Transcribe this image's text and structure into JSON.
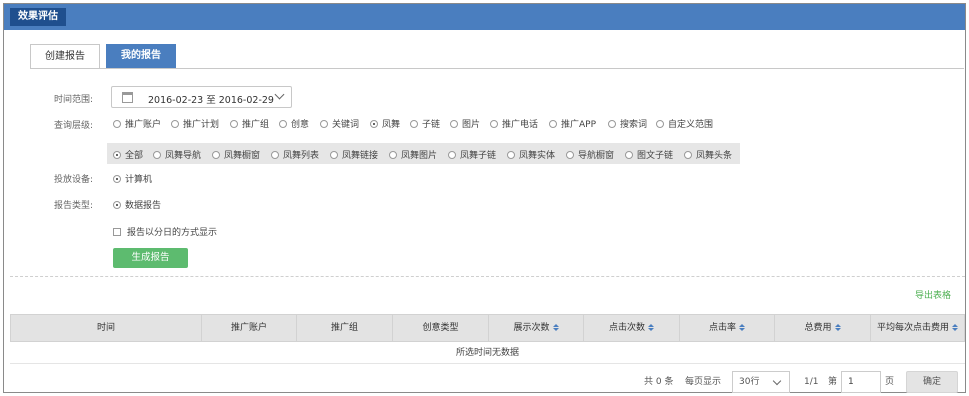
{
  "header": {
    "title": "效果评估"
  },
  "tabs": {
    "create": "创建报告",
    "mine": "我的报告"
  },
  "time_range": {
    "label": "时间范围:",
    "value": "2016-02-23 至 2016-02-29"
  },
  "query_level": {
    "label": "查询层级:",
    "options": [
      "推广账户",
      "推广计划",
      "推广组",
      "创意",
      "关键词",
      "凤舞",
      "子链",
      "图片",
      "推广电话",
      "推广APP",
      "搜索词",
      "自定义范围"
    ],
    "selected": "凤舞"
  },
  "fengwu_sub": {
    "options": [
      "全部",
      "凤舞导航",
      "凤舞橱窗",
      "凤舞列表",
      "凤舞链接",
      "凤舞图片",
      "凤舞子链",
      "凤舞实体",
      "导航橱窗",
      "图文子链",
      "凤舞头条"
    ],
    "selected": "全部"
  },
  "device": {
    "label": "投放设备:",
    "option": "计算机"
  },
  "report_type": {
    "label": "报告类型:",
    "option": "数据报告"
  },
  "by_day_checkbox": "报告以分日的方式显示",
  "generate_button": "生成报告",
  "export_link": "导出表格",
  "table": {
    "headers": [
      "时间",
      "推广账户",
      "推广组",
      "创意类型",
      "展示次数",
      "点击次数",
      "点击率",
      "总费用",
      "平均每次点击费用"
    ],
    "empty_text": "所选时间无数据"
  },
  "pagination": {
    "total": "共 0 条",
    "per_page_label": "每页显示",
    "per_page_value": "30行",
    "page_info": "1/1",
    "goto_prefix": "第",
    "goto_value": "1",
    "goto_suffix": "页",
    "confirm": "确定"
  }
}
